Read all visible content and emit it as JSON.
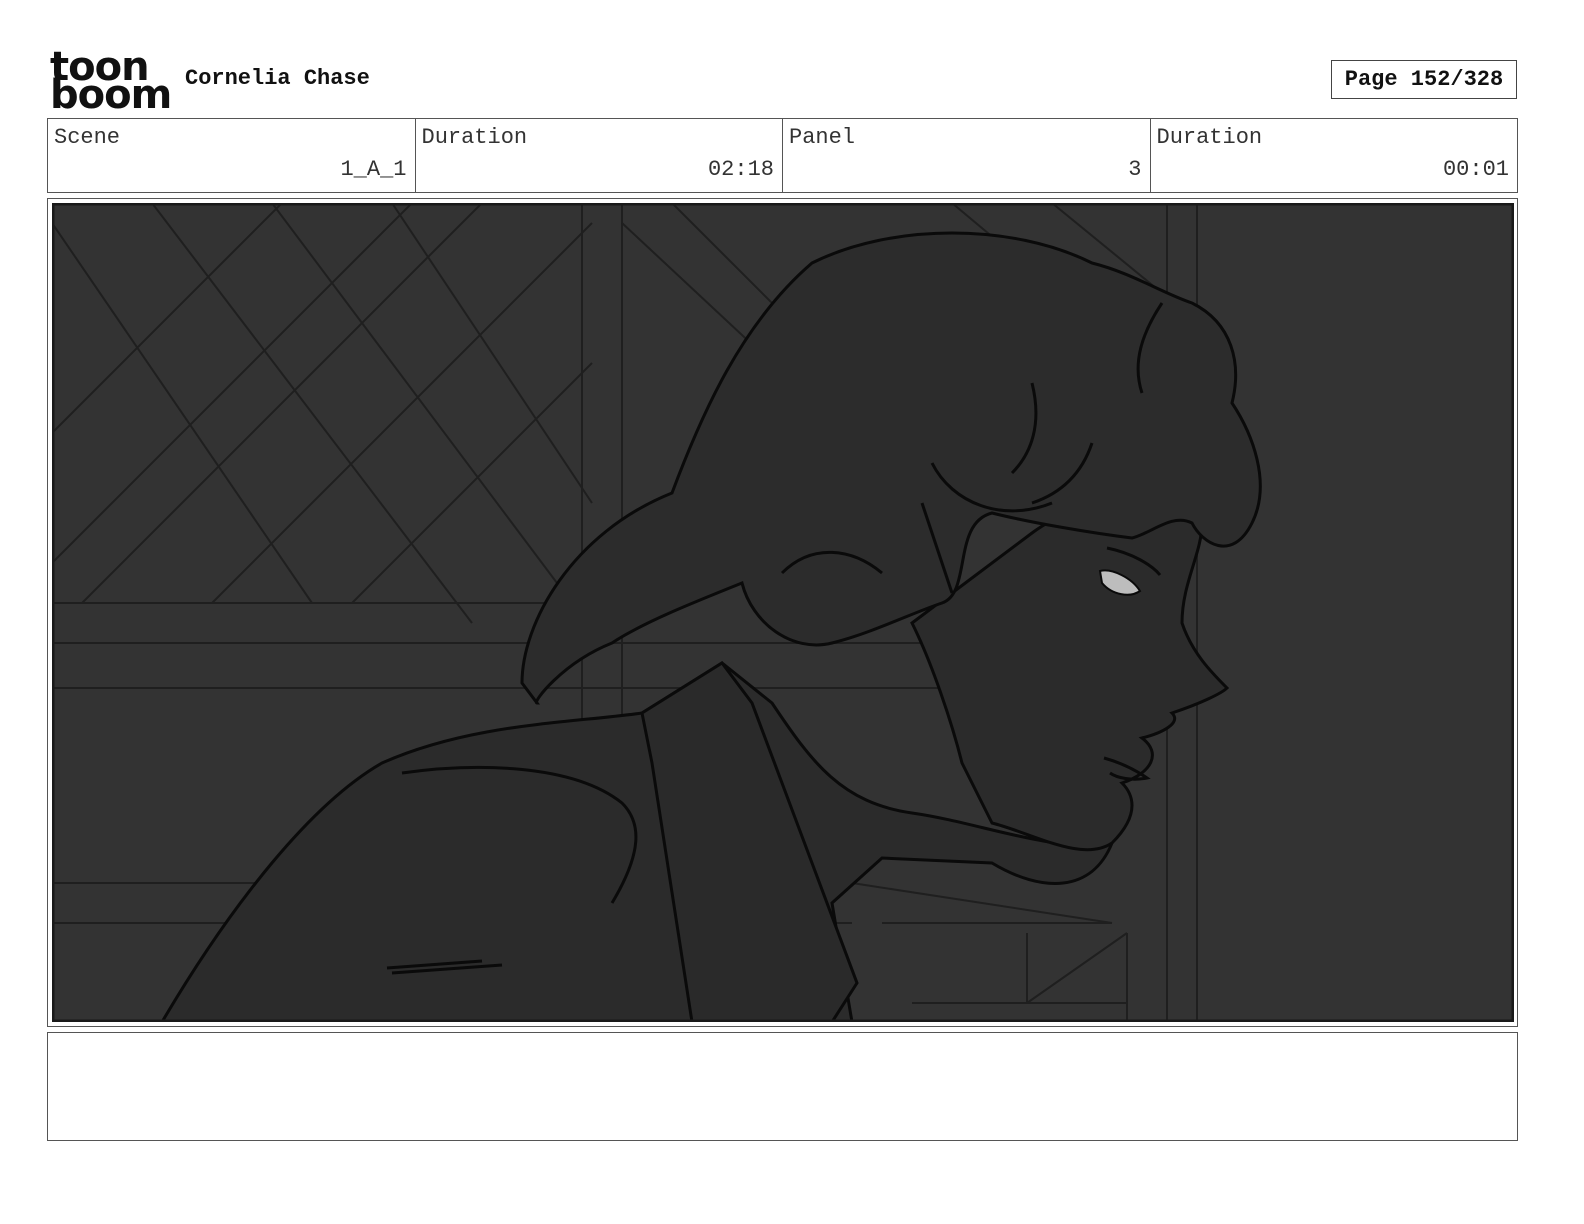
{
  "header": {
    "logo": {
      "line1": "toon",
      "line2": "boom"
    },
    "project_title": "Cornelia Chase",
    "page_label": "Page 152/328"
  },
  "info": {
    "scene_label": "Scene",
    "scene_value": "1_A_1",
    "scene_duration_label": "Duration",
    "scene_duration_value": "02:18",
    "panel_label": "Panel",
    "panel_value": "3",
    "panel_duration_label": "Duration",
    "panel_duration_value": "00:01"
  },
  "panel": {
    "background_color": "#333333",
    "figure_fill": "#2b2b2b",
    "line_color": "#0a0a0a",
    "eye_highlight": "#bdbdbd"
  },
  "notes": {
    "text": ""
  }
}
